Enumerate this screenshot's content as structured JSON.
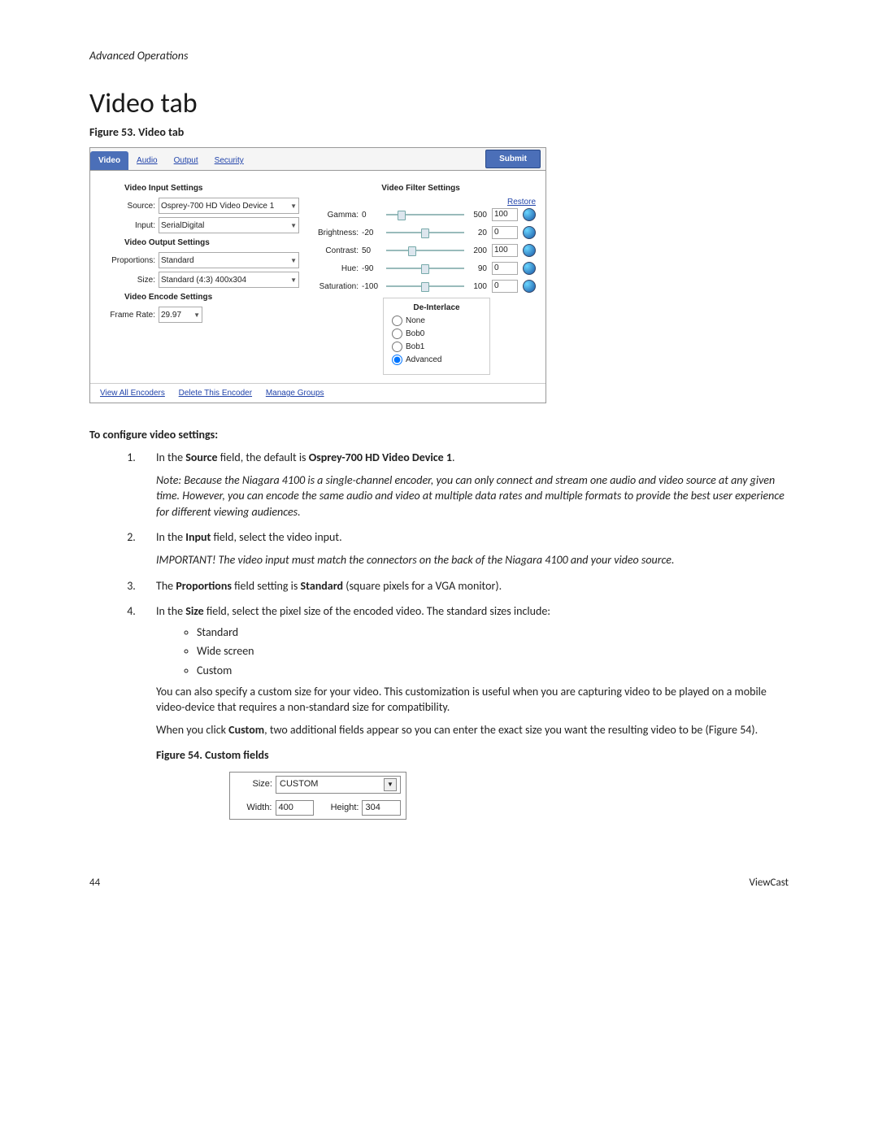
{
  "header": "Advanced Operations",
  "title": "Video tab",
  "figure53_caption": "Figure 53. Video tab",
  "screenshot": {
    "tabs": [
      "Video",
      "Audio",
      "Output",
      "Security"
    ],
    "active_tab": "Video",
    "submit": "Submit",
    "left": {
      "input_settings_title": "Video Input Settings",
      "source_label": "Source:",
      "source_value": "Osprey-700 HD Video Device 1",
      "input_label": "Input:",
      "input_value": "SerialDigital",
      "output_settings_title": "Video Output Settings",
      "proportions_label": "Proportions:",
      "proportions_value": "Standard",
      "size_label": "Size:",
      "size_value": "Standard (4:3) 400x304",
      "encode_settings_title": "Video Encode Settings",
      "framerate_label": "Frame Rate:",
      "framerate_value": "29.97"
    },
    "right": {
      "filter_title": "Video Filter Settings",
      "restore": "Restore",
      "sliders": [
        {
          "label": "Gamma:",
          "min": "0",
          "max": "500",
          "value": "100",
          "pos": 20
        },
        {
          "label": "Brightness:",
          "min": "-20",
          "max": "20",
          "value": "0",
          "pos": 50
        },
        {
          "label": "Contrast:",
          "min": "50",
          "max": "200",
          "value": "100",
          "pos": 33
        },
        {
          "label": "Hue:",
          "min": "-90",
          "max": "90",
          "value": "0",
          "pos": 50
        },
        {
          "label": "Saturation:",
          "min": "-100",
          "max": "100",
          "value": "0",
          "pos": 50
        }
      ],
      "deinterlace": {
        "title": "De-Interlace",
        "options": [
          "None",
          "Bob0",
          "Bob1",
          "Advanced"
        ],
        "selected": "Advanced"
      }
    },
    "footer_links": [
      "View All Encoders",
      "Delete This Encoder",
      "Manage Groups"
    ]
  },
  "instructions": {
    "heading": "To configure video settings:",
    "step1_a": "In the ",
    "step1_b": "Source",
    "step1_c": " field, the default is ",
    "step1_d": "Osprey-700 HD Video Device 1",
    "step1_e": ".",
    "step1_note": "Note: Because the Niagara 4100 is a single-channel encoder, you can only connect and stream one audio and video source at any given time. However, you can encode the same audio and video at multiple data rates and multiple formats to provide the best user experience for different viewing audiences.",
    "step2_a": "In the ",
    "step2_b": "Input",
    "step2_c": " field, select the video input.",
    "step2_note": "IMPORTANT! The video input must match the connectors on the back of the Niagara 4100 and your video source.",
    "step3_a": "The ",
    "step3_b": "Proportions",
    "step3_c": " field setting is ",
    "step3_d": "Standard",
    "step3_e": "  (square pixels for a VGA monitor).",
    "step4_a": "In the ",
    "step4_b": "Size",
    "step4_c": " field, select the pixel size of the encoded video. The standard sizes include:",
    "step4_bullets": [
      "Standard",
      "Wide screen",
      "Custom"
    ],
    "step4_para1": "You can also specify a custom size for your video. This customization is useful when you are capturing video to be played on a mobile video-device that requires a non-standard size for compatibility.",
    "step4_para2a": "When you click ",
    "step4_para2b": "Custom",
    "step4_para2c": ", two additional fields appear so you can enter the exact size you want the resulting video to be (Figure 54)."
  },
  "figure54_caption": "Figure 54. Custom fields",
  "figure54": {
    "size_label": "Size:",
    "size_value": "CUSTOM",
    "width_label": "Width:",
    "width_value": "400",
    "height_label": "Height:",
    "height_value": "304"
  },
  "footer": {
    "page": "44",
    "brand": "ViewCast"
  }
}
